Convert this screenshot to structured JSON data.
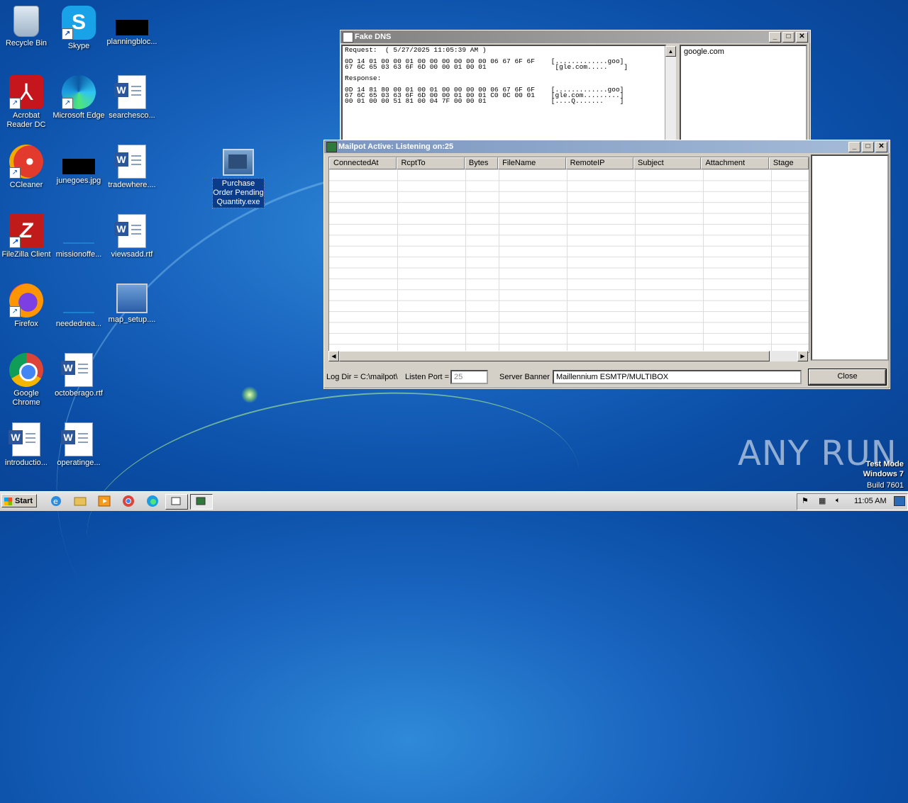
{
  "desktop": {
    "icons": [
      {
        "label": "Recycle Bin",
        "icon": "recycle-bin-icon"
      },
      {
        "label": "Skype",
        "icon": "skype-icon"
      },
      {
        "label": "planningbloc...",
        "icon": "black-thumbnail-icon"
      },
      {
        "label": "Acrobat Reader DC",
        "icon": "acrobat-icon"
      },
      {
        "label": "Microsoft Edge",
        "icon": "edge-icon"
      },
      {
        "label": "searchesco...",
        "icon": "word-doc-icon"
      },
      {
        "label": "CCleaner",
        "icon": "ccleaner-icon"
      },
      {
        "label": "junegoes.jpg",
        "icon": "black-thumbnail-icon"
      },
      {
        "label": "tradewhere....",
        "icon": "word-doc-icon"
      },
      {
        "label": "FileZilla Client",
        "icon": "filezilla-icon"
      },
      {
        "label": "missionoffe...",
        "icon": "blank-file-icon"
      },
      {
        "label": "viewsadd.rtf",
        "icon": "word-doc-icon"
      },
      {
        "label": "Firefox",
        "icon": "firefox-icon"
      },
      {
        "label": "neededneа...",
        "icon": "blank-file-icon"
      },
      {
        "label": "map_setup....",
        "icon": "installer-icon"
      },
      {
        "label": "Google Chrome",
        "icon": "chrome-icon"
      },
      {
        "label": "octoberago.rtf",
        "icon": "word-doc-icon"
      },
      {
        "label": "introductio...",
        "icon": "word-doc-icon"
      },
      {
        "label": "operatinge...",
        "icon": "word-doc-icon"
      },
      {
        "label": "Purchase Order Pending Quantity.exe",
        "icon": "exe-icon"
      }
    ]
  },
  "fake_dns": {
    "title": "Fake DNS",
    "log_text": "Request:  ( 5/27/2025 11:05:39 AM )\n\n0D 14 01 00 00 01 00 00 00 00 00 00 06 67 6F 6F    [.............goo]\n67 6C 65 03 63 6F 6D 00 00 01 00 01                 [gle.com.....    ]\n\nResponse:\n\n0D 14 81 80 00 01 00 01 00 00 00 00 06 67 6F 6F    [.............goo]\n67 6C 65 03 63 6F 6D 00 00 01 00 01 C0 0C 00 01    [gle.com.........]\n00 01 00 00 51 81 00 04 7F 00 00 01                [....Q.......    ]",
    "domains": [
      "google.com"
    ]
  },
  "mailpot": {
    "title": "Mailpot Active: Listening on:25",
    "columns": [
      "ConnectedAt",
      "RcptTo",
      "Bytes",
      "FileName",
      "RemoteIP",
      "Subject",
      "Attachment",
      "Stage"
    ],
    "log_dir_label": "Log Dir = C:\\mailpot\\",
    "listen_port_label": "Listen Port =",
    "listen_port_value": "25",
    "server_banner_label": "Server Banner",
    "server_banner_value": "Maillennium ESMTP/MULTIBOX",
    "close_label": "Close"
  },
  "taskbar": {
    "start_label": "Start",
    "clock": "11:05 AM"
  },
  "watermark": {
    "brand": "ANY RUN",
    "test_mode": "Test Mode",
    "os": "Windows 7",
    "build": "Build 7601"
  }
}
